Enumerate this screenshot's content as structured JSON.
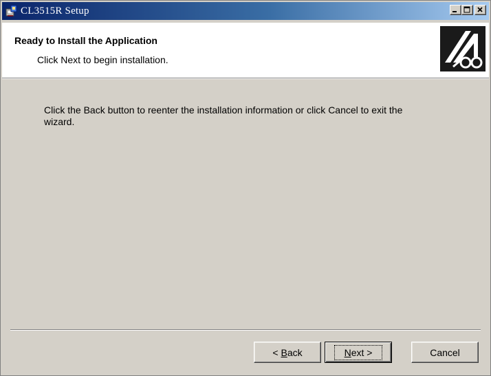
{
  "window": {
    "title": "CL3515R Setup"
  },
  "banner": {
    "title": "Ready to Install the Application",
    "subtitle": "Click Next to begin installation."
  },
  "body": {
    "message": "Click the Back button to reenter the installation information or click Cancel to exit the wizard."
  },
  "buttons": {
    "back": {
      "prefix": "< ",
      "mnemonic": "B",
      "rest": "ack"
    },
    "next": {
      "mnemonic": "N",
      "rest": "ext >"
    },
    "cancel": "Cancel"
  },
  "icons": {
    "app": "setup-app-icon",
    "minimize": "minimize-icon",
    "maximize": "maximize-icon",
    "close": "close-icon",
    "logo": "installer-logo"
  },
  "colors": {
    "titlebar_start": "#0a246a",
    "titlebar_end": "#a6caf0",
    "dialog_bg": "#d4d0c8",
    "banner_bg": "#ffffff"
  }
}
